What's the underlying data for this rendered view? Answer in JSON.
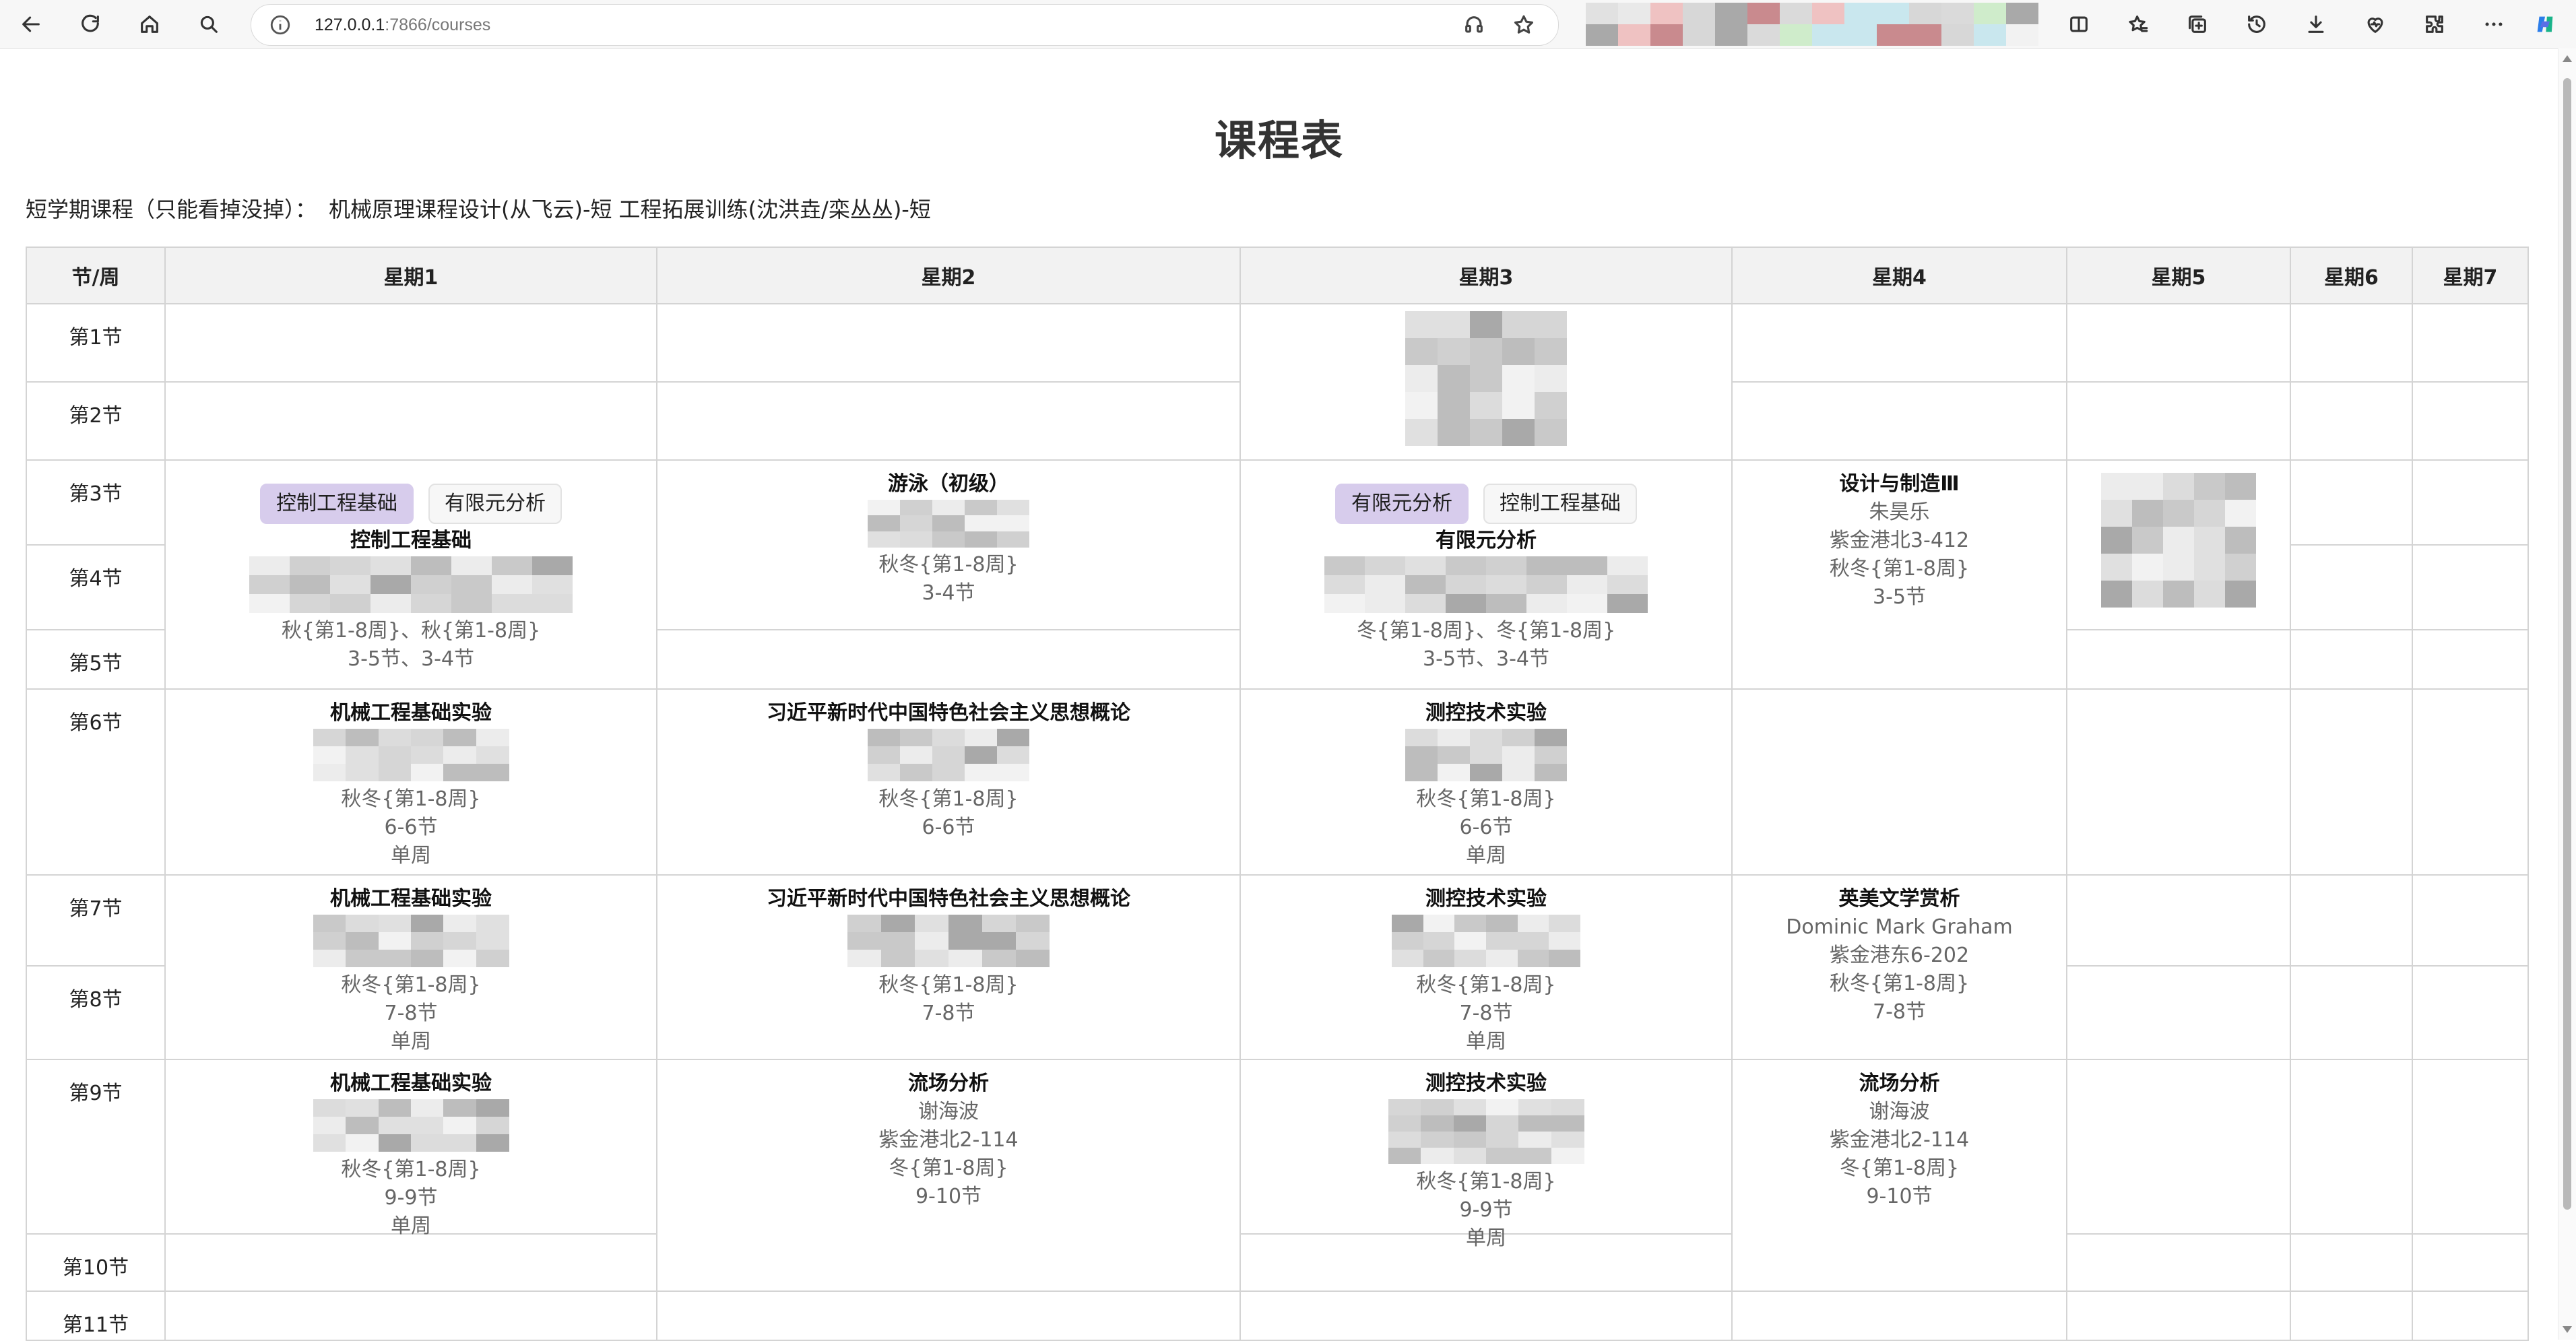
{
  "browser": {
    "url_host": "127.0.0.1",
    "url_rest": ":7866/courses"
  },
  "page": {
    "title": "课程表",
    "short_term_label": "短学期课程（只能看掉没掉）：",
    "short_term_courses": [
      "机械原理课程设计(从飞云)-短",
      "工程拓展训练(沈洪垚/栾丛丛)-短"
    ]
  },
  "table": {
    "corner": "节/周",
    "days": [
      "星期1",
      "星期2",
      "星期3",
      "星期4",
      "星期5",
      "星期6",
      "星期7"
    ],
    "periods": [
      "第1节",
      "第2节",
      "第3节",
      "第4节",
      "第5节",
      "第6节",
      "第7节",
      "第8节",
      "第9节",
      "第10节",
      "第11节"
    ]
  },
  "courses": {
    "mon_3_5": {
      "tabs": [
        "控制工程基础",
        "有限元分析"
      ],
      "active_tab": "控制工程基础",
      "name": "控制工程基础",
      "weeks": "秋{第1-8周}、秋{第1-8周}",
      "periods": "3-5节、3-4节"
    },
    "mon_6": {
      "name": "机械工程基础实验",
      "weeks": "秋冬{第1-8周}",
      "periods": "6-6节",
      "note": "单周"
    },
    "mon_7_8": {
      "name": "机械工程基础实验",
      "weeks": "秋冬{第1-8周}",
      "periods": "7-8节",
      "note": "单周"
    },
    "mon_9": {
      "name": "机械工程基础实验",
      "weeks": "秋冬{第1-8周}",
      "periods": "9-9节",
      "note": "单周"
    },
    "tue_3_4": {
      "name": "游泳（初级）",
      "weeks": "秋冬{第1-8周}",
      "periods": "3-4节"
    },
    "tue_6": {
      "name": "习近平新时代中国特色社会主义思想概论",
      "weeks": "秋冬{第1-8周}",
      "periods": "6-6节"
    },
    "tue_7_8": {
      "name": "习近平新时代中国特色社会主义思想概论",
      "weeks": "秋冬{第1-8周}",
      "periods": "7-8节"
    },
    "tue_9_10": {
      "name": "流场分析",
      "teacher": "谢海波",
      "room": "紫金港北2-114",
      "weeks": "冬{第1-8周}",
      "periods": "9-10节"
    },
    "wed_3_5": {
      "tabs": [
        "有限元分析",
        "控制工程基础"
      ],
      "active_tab": "有限元分析",
      "name": "有限元分析",
      "weeks": "冬{第1-8周}、冬{第1-8周}",
      "periods": "3-5节、3-4节"
    },
    "wed_6": {
      "name": "测控技术实验",
      "weeks": "秋冬{第1-8周}",
      "periods": "6-6节",
      "note": "单周"
    },
    "wed_7_8": {
      "name": "测控技术实验",
      "weeks": "秋冬{第1-8周}",
      "periods": "7-8节",
      "note": "单周"
    },
    "wed_9": {
      "name": "测控技术实验",
      "weeks": "秋冬{第1-8周}",
      "periods": "9-9节",
      "note": "单周"
    },
    "thu_3_5": {
      "name": "设计与制造Ⅲ",
      "teacher": "朱昊乐",
      "room": "紫金港北3-412",
      "weeks": "秋冬{第1-8周}",
      "periods": "3-5节"
    },
    "thu_7_8": {
      "name": "英美文学赏析",
      "teacher": "Dominic Mark Graham",
      "room": "紫金港东6-202",
      "weeks": "秋冬{第1-8周}",
      "periods": "7-8节"
    },
    "thu_9_10": {
      "name": "流场分析",
      "teacher": "谢海波",
      "room": "紫金港北2-114",
      "weeks": "冬{第1-8周}",
      "periods": "9-10节"
    }
  },
  "colors": {
    "header_bg": "#f2f2f2",
    "border": "#d4d4d4",
    "active_tab": "#d7ccec",
    "muted_text": "#666666"
  },
  "icons": [
    "back-icon",
    "refresh-icon",
    "home-icon",
    "search-icon",
    "info-icon",
    "read-aloud-icon",
    "favorite-star-icon",
    "split-screen-icon",
    "favorites-icon",
    "collections-icon",
    "history-icon",
    "download-icon",
    "health-icon",
    "extensions-icon",
    "more-icon",
    "copilot-icon"
  ]
}
